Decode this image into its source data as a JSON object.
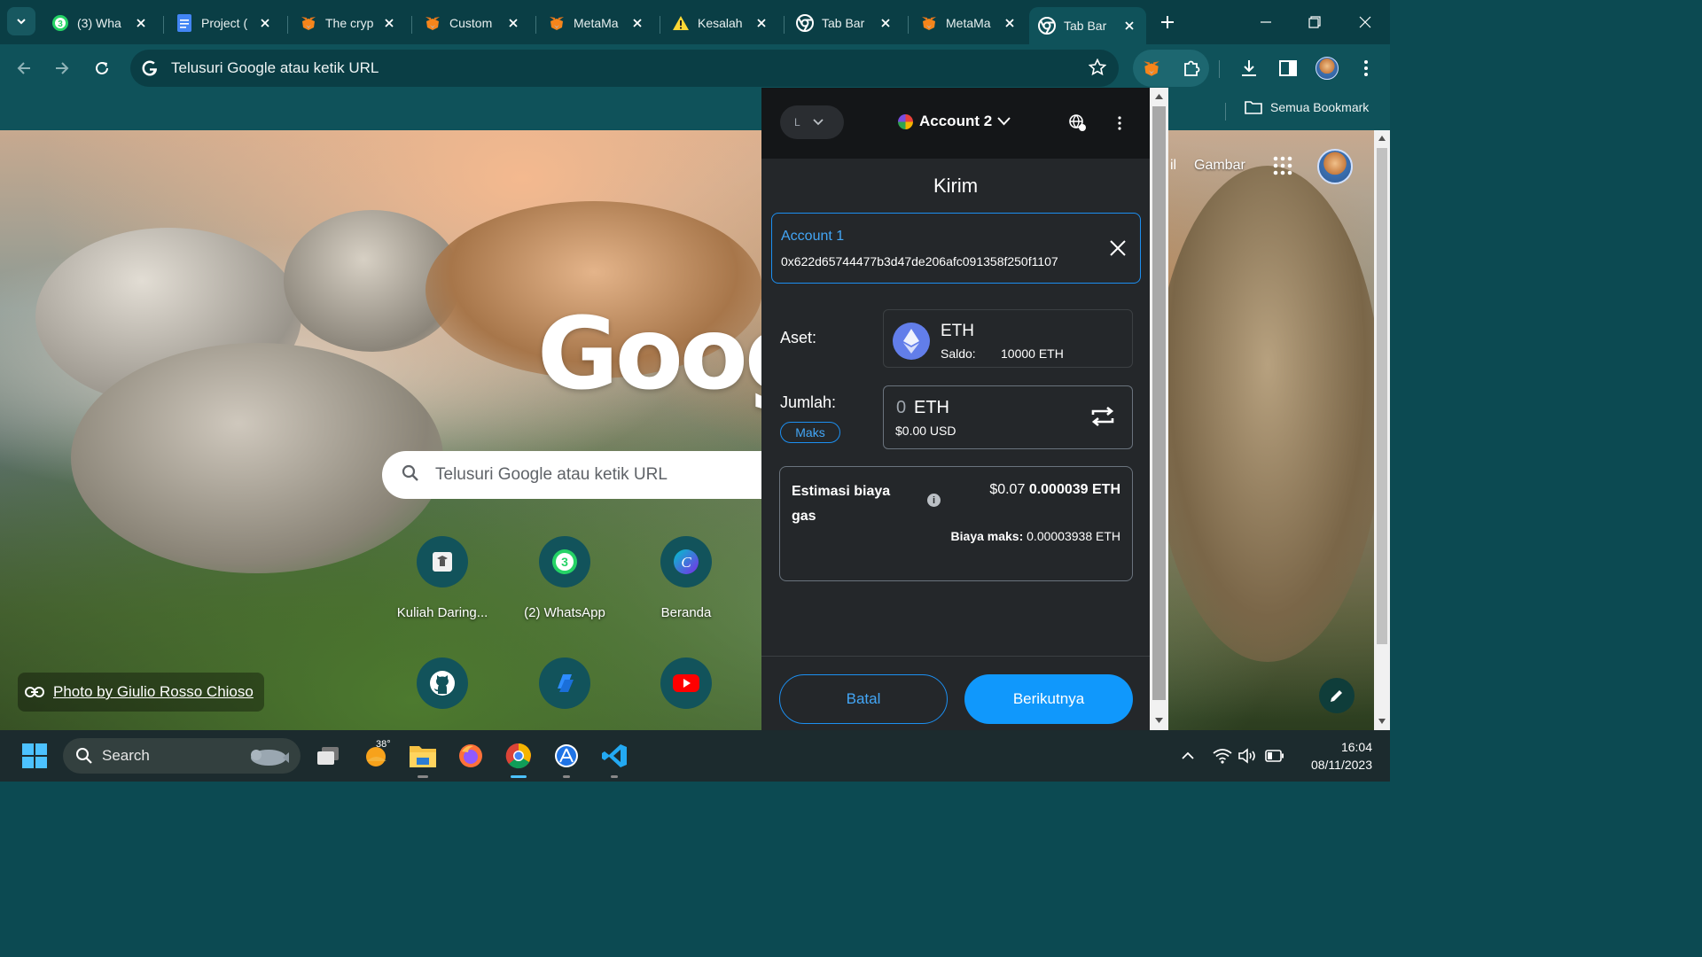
{
  "browser": {
    "tabs": [
      {
        "title": "(3) Wha",
        "icon": "whatsapp-icon",
        "badge": "3"
      },
      {
        "title": "Project (",
        "icon": "google-docs-icon"
      },
      {
        "title": "The cryp",
        "icon": "metamask-fox-icon"
      },
      {
        "title": "Custom",
        "icon": "metamask-fox-icon"
      },
      {
        "title": "MetaMa",
        "icon": "metamask-fox-icon"
      },
      {
        "title": "Kesalah",
        "icon": "warning-icon"
      },
      {
        "title": "Tab Bar",
        "icon": "chrome-icon"
      },
      {
        "title": "MetaMa",
        "icon": "metamask-fox-icon"
      },
      {
        "title": "Tab Bar",
        "icon": "chrome-icon",
        "active": true
      }
    ],
    "omnibox": {
      "placeholder": "Telusuri Google atau ketik URL"
    },
    "bookmarks": {
      "all_label": "Semua Bookmark"
    },
    "colors": {
      "chrome_frame": "#0a3e45",
      "toolbar": "#0f525a"
    }
  },
  "ntp": {
    "gmail_fragment": "il",
    "images_link": "Gambar",
    "logo_text": "Goog",
    "search_placeholder": "Telusuri Google atau ketik URL",
    "shortcuts": [
      {
        "label": "Kuliah Daring...",
        "icon": "graduation-icon"
      },
      {
        "label": "(2) WhatsApp",
        "icon": "whatsapp-icon",
        "badge": "3"
      },
      {
        "label": "Beranda",
        "icon": "canva-icon",
        "letter": "C"
      },
      {
        "label": "",
        "icon": "github-icon"
      },
      {
        "label": "",
        "icon": "zoom-icon"
      },
      {
        "label": "",
        "icon": "youtube-icon"
      }
    ],
    "photo_credit": "Photo by Giulio Rosso Chioso"
  },
  "metamask": {
    "network_initial": "L",
    "account_name": "Account 2",
    "page_title": "Kirim",
    "recipient": {
      "name": "Account 1",
      "address": "0x622d65744477b3d47de206afc091358f250f1107"
    },
    "asset": {
      "label": "Aset:",
      "symbol": "ETH",
      "balance_label": "Saldo:",
      "balance_value": "10000 ETH"
    },
    "amount": {
      "label": "Jumlah:",
      "value": "0",
      "unit": "ETH",
      "fiat": "$0.00 USD",
      "max_label": "Maks"
    },
    "gas": {
      "label": "Estimasi biaya gas",
      "fiat": "$0.07",
      "eth": "0.000039 ETH",
      "max_label": "Biaya maks:",
      "max_value": "0.00003938 ETH"
    },
    "buttons": {
      "cancel": "Batal",
      "next": "Berikutnya"
    },
    "colors": {
      "accent": "#1098fc",
      "background": "#24272a",
      "header": "#141618"
    }
  },
  "taskbar": {
    "search_label": "Search",
    "weather_temp": "38°",
    "time": "16:04",
    "date": "08/11/2023"
  }
}
